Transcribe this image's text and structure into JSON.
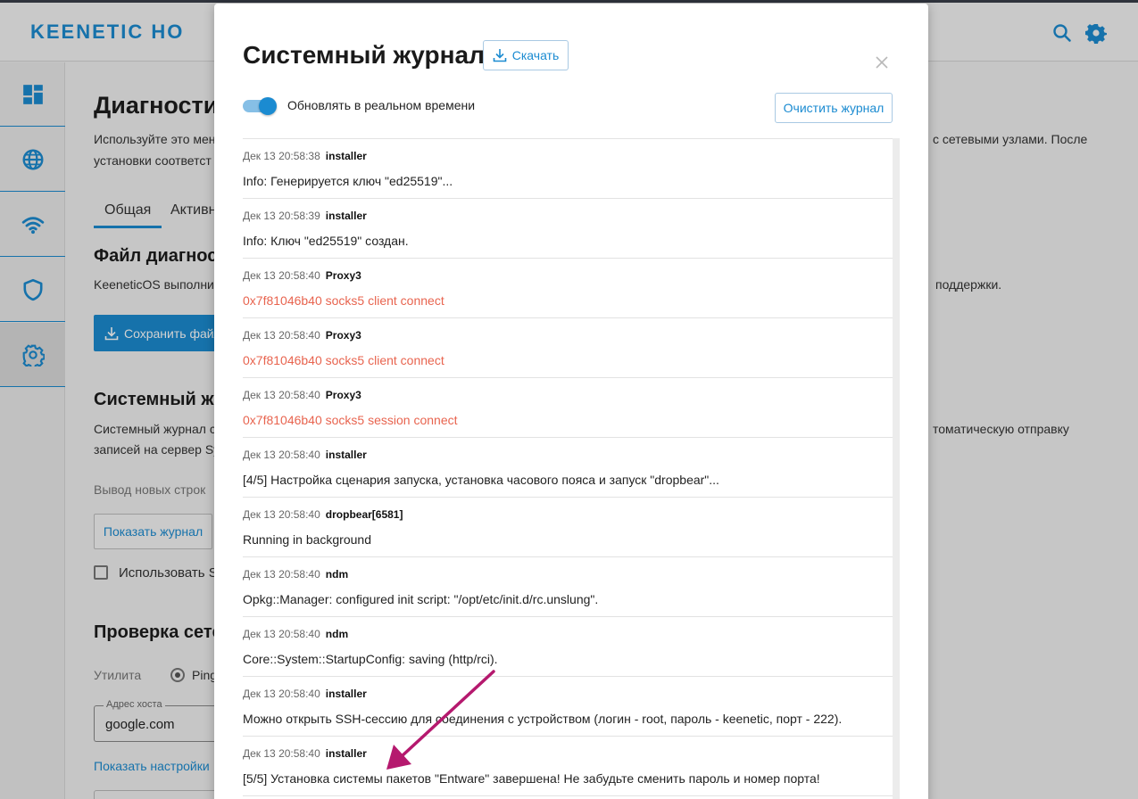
{
  "app": {
    "logo_text": "KEENETIC HO"
  },
  "sidebar": {
    "items": [
      {
        "icon": "dashboard-icon"
      },
      {
        "icon": "globe-icon"
      },
      {
        "icon": "wifi-icon"
      },
      {
        "icon": "shield-icon"
      },
      {
        "icon": "gear-icon",
        "active": true
      }
    ]
  },
  "background": {
    "page_title": "Диагности",
    "intro_line1_left": "Используйте это мен",
    "intro_line1_right": "с сетевыми узлами. После",
    "intro_line2": "установки соответст",
    "tabs": [
      "Общая",
      "Активн"
    ],
    "diag_file_heading": "Файл диагност",
    "diag_file_text_left": "KeeneticOS выполни",
    "diag_file_text_right": "поддержки.",
    "save_file_button": "Сохранить файл",
    "syslog_heading": "Системный жу",
    "syslog_text1_left": "Системный журнал с",
    "syslog_text1_right": "томатическую отправку",
    "syslog_text2": "записей на сервер Sy",
    "new_lines_label": "Вывод новых строк",
    "show_log_button": "Показать журнал",
    "use_syslog_label": "Использовать Sy",
    "network_check_heading": "Проверка сете",
    "utility_label": "Утилита",
    "ping_option": "Ping",
    "host_field_label": "Адрес хоста",
    "host_field_value": "google.com",
    "show_settings_link": "Показать настройки"
  },
  "modal": {
    "title": "Системный журнал",
    "download_label": "Скачать",
    "realtime_label": "Обновлять в реальном времени",
    "realtime_enabled": true,
    "clear_label": "Очистить журнал",
    "entries": [
      {
        "time": "Дек 13 20:58:38",
        "source": "installer",
        "message": "Info: Генерируется ключ \"ed25519\"...",
        "level": "info"
      },
      {
        "time": "Дек 13 20:58:39",
        "source": "installer",
        "message": "Info: Ключ \"ed25519\" создан.",
        "level": "info"
      },
      {
        "time": "Дек 13 20:58:40",
        "source": "Proxy3",
        "message": "0x7f81046b40 socks5 client connect",
        "level": "error"
      },
      {
        "time": "Дек 13 20:58:40",
        "source": "Proxy3",
        "message": "0x7f81046b40 socks5 client connect",
        "level": "error"
      },
      {
        "time": "Дек 13 20:58:40",
        "source": "Proxy3",
        "message": "0x7f81046b40 socks5 session connect",
        "level": "error"
      },
      {
        "time": "Дек 13 20:58:40",
        "source": "installer",
        "message": "[4/5] Настройка сценария запуска, установка часового пояса и запуск \"dropbear\"...",
        "level": "info"
      },
      {
        "time": "Дек 13 20:58:40",
        "source": "dropbear[6581]",
        "message": "Running in background",
        "level": "info"
      },
      {
        "time": "Дек 13 20:58:40",
        "source": "ndm",
        "message": "Opkg::Manager: configured init script: \"/opt/etc/init.d/rc.unslung\".",
        "level": "info"
      },
      {
        "time": "Дек 13 20:58:40",
        "source": "ndm",
        "message": "Core::System::StartupConfig: saving (http/rci).",
        "level": "info"
      },
      {
        "time": "Дек 13 20:58:40",
        "source": "installer",
        "message": "Можно открыть SSH-сессию для соединения с устройством (логин - root, пароль - keenetic, порт - 222).",
        "level": "info"
      },
      {
        "time": "Дек 13 20:58:40",
        "source": "installer",
        "message": "[5/5] Установка системы пакетов \"Entware\" завершена! Не забудьте сменить пароль и номер порта!",
        "level": "info"
      }
    ]
  },
  "colors": {
    "accent": "#1b8bd1",
    "error_text": "#e8644f",
    "annotation_arrow": "#b5196e"
  }
}
